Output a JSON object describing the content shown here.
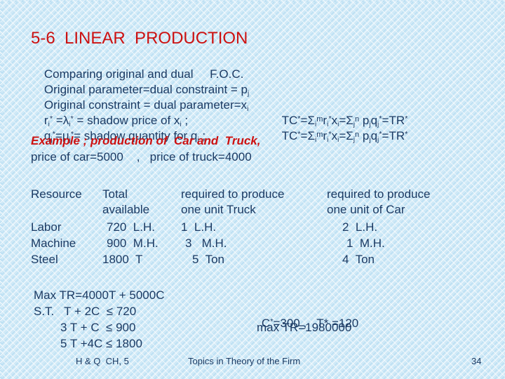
{
  "slide": {
    "title": "5-6  LINEAR  PRODUCTION",
    "page_number": "34",
    "title_color": "#cc1111",
    "body_color": "#1b3a63",
    "background_color": "#cfe9f7"
  },
  "intro": {
    "line1": "Comparing original and dual     F.O.C.",
    "line2_a": "Original parameter=dual constraint = p",
    "line2_sub": "j",
    "line3_a": "Original constraint = dual parameter=x",
    "line3_sub": "i",
    "line4": {
      "r": "r",
      "r_sub": "i",
      "r_sup": "*",
      "eq": " =",
      "lambda": "λ",
      "lambda_sub": "i",
      "lambda_sup": "*",
      "rest": " = shadow price of x",
      "rest_sub": "i",
      "tail": " ;"
    },
    "line5": {
      "q": "q",
      "q_sub": "j",
      "q_sup": "*",
      "eq": "=",
      "mu": "μ",
      "mu_sub": "j",
      "mu_sup": "*",
      "rest": "= shadow quantity for q",
      "rest_sub": "j",
      "tail": " ;"
    },
    "example": "Example ; production of  Car and  Truck,",
    "prices": "price of car=5000    ,   price of truck=4000"
  },
  "formula": {
    "tc": "TC",
    "tc_sup": "*",
    "eq1": "=",
    "sigma": "Σ",
    "sigma1_sub": "i",
    "sigma1_sup": "m",
    "r": "r",
    "r_sub": "i",
    "r_sup": "*",
    "x": "x",
    "x_sub": "i",
    "eq2": "=",
    "sigma2_sub": "j",
    "sigma2_sup": "n",
    "p": " p",
    "p_sub": "j",
    "q": "q",
    "q_sub": "j",
    "q_sup": "*",
    "eq3": "=TR",
    "tr_sup": "*"
  },
  "table": {
    "headers": {
      "col1_line1": "Resource",
      "col1_line2": "",
      "col2_line1": "Total",
      "col2_line2": "available",
      "col3_line1": "required to produce",
      "col3_line2": "one unit Truck",
      "col4_line1": "required to produce",
      "col4_line2": "one unit of Car"
    },
    "rows": [
      {
        "resource": "Labor",
        "available": "720  L.H.",
        "truck": "1  L.H.",
        "car": "2  L.H."
      },
      {
        "resource": "Machine",
        "available": "900  M.H.",
        "truck": "3   M.H.",
        "car": "1  M.H."
      },
      {
        "resource": "Steel",
        "available": "1800  T",
        "truck": "5  Ton",
        "car": "4  Ton"
      }
    ]
  },
  "program": {
    "objective": "Max TR=4000T + 5000C",
    "st_line1": "S.T.   T + 2C  ≤ 720",
    "st_line2": "3 T + C  ≤ 900",
    "st_line3": "5 T +4C ≤ 1800",
    "solution": {
      "c_label": "C",
      "c_sup": "*",
      "c_value": "=300 ,",
      "t_label": "T* =120",
      "max_tr": "max TR=1980000"
    }
  },
  "footer": {
    "left": "H & Q  CH, 5",
    "center": "Topics in Theory of the Firm"
  }
}
